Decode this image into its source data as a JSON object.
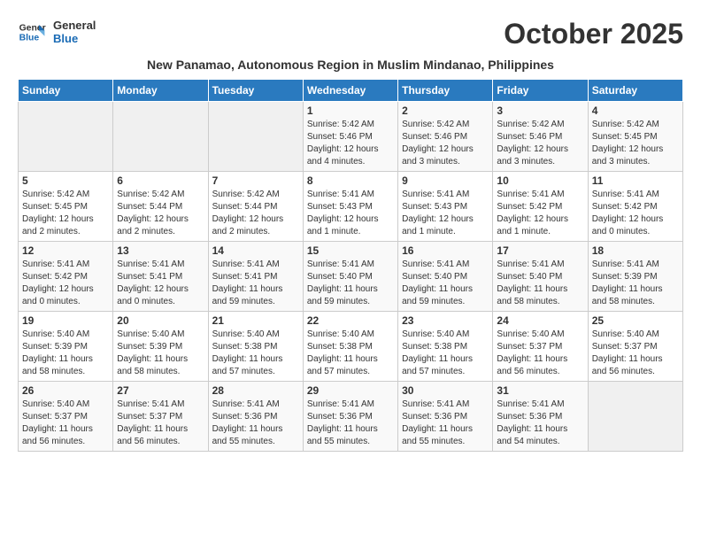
{
  "header": {
    "logo_line1": "General",
    "logo_line2": "Blue",
    "month_title": "October 2025",
    "subtitle": "New Panamao, Autonomous Region in Muslim Mindanao, Philippines"
  },
  "days_of_week": [
    "Sunday",
    "Monday",
    "Tuesday",
    "Wednesday",
    "Thursday",
    "Friday",
    "Saturday"
  ],
  "weeks": [
    [
      {
        "day": "",
        "info": ""
      },
      {
        "day": "",
        "info": ""
      },
      {
        "day": "",
        "info": ""
      },
      {
        "day": "1",
        "info": "Sunrise: 5:42 AM\nSunset: 5:46 PM\nDaylight: 12 hours\nand 4 minutes."
      },
      {
        "day": "2",
        "info": "Sunrise: 5:42 AM\nSunset: 5:46 PM\nDaylight: 12 hours\nand 3 minutes."
      },
      {
        "day": "3",
        "info": "Sunrise: 5:42 AM\nSunset: 5:46 PM\nDaylight: 12 hours\nand 3 minutes."
      },
      {
        "day": "4",
        "info": "Sunrise: 5:42 AM\nSunset: 5:45 PM\nDaylight: 12 hours\nand 3 minutes."
      }
    ],
    [
      {
        "day": "5",
        "info": "Sunrise: 5:42 AM\nSunset: 5:45 PM\nDaylight: 12 hours\nand 2 minutes."
      },
      {
        "day": "6",
        "info": "Sunrise: 5:42 AM\nSunset: 5:44 PM\nDaylight: 12 hours\nand 2 minutes."
      },
      {
        "day": "7",
        "info": "Sunrise: 5:42 AM\nSunset: 5:44 PM\nDaylight: 12 hours\nand 2 minutes."
      },
      {
        "day": "8",
        "info": "Sunrise: 5:41 AM\nSunset: 5:43 PM\nDaylight: 12 hours\nand 1 minute."
      },
      {
        "day": "9",
        "info": "Sunrise: 5:41 AM\nSunset: 5:43 PM\nDaylight: 12 hours\nand 1 minute."
      },
      {
        "day": "10",
        "info": "Sunrise: 5:41 AM\nSunset: 5:42 PM\nDaylight: 12 hours\nand 1 minute."
      },
      {
        "day": "11",
        "info": "Sunrise: 5:41 AM\nSunset: 5:42 PM\nDaylight: 12 hours\nand 0 minutes."
      }
    ],
    [
      {
        "day": "12",
        "info": "Sunrise: 5:41 AM\nSunset: 5:42 PM\nDaylight: 12 hours\nand 0 minutes."
      },
      {
        "day": "13",
        "info": "Sunrise: 5:41 AM\nSunset: 5:41 PM\nDaylight: 12 hours\nand 0 minutes."
      },
      {
        "day": "14",
        "info": "Sunrise: 5:41 AM\nSunset: 5:41 PM\nDaylight: 11 hours\nand 59 minutes."
      },
      {
        "day": "15",
        "info": "Sunrise: 5:41 AM\nSunset: 5:40 PM\nDaylight: 11 hours\nand 59 minutes."
      },
      {
        "day": "16",
        "info": "Sunrise: 5:41 AM\nSunset: 5:40 PM\nDaylight: 11 hours\nand 59 minutes."
      },
      {
        "day": "17",
        "info": "Sunrise: 5:41 AM\nSunset: 5:40 PM\nDaylight: 11 hours\nand 58 minutes."
      },
      {
        "day": "18",
        "info": "Sunrise: 5:41 AM\nSunset: 5:39 PM\nDaylight: 11 hours\nand 58 minutes."
      }
    ],
    [
      {
        "day": "19",
        "info": "Sunrise: 5:40 AM\nSunset: 5:39 PM\nDaylight: 11 hours\nand 58 minutes."
      },
      {
        "day": "20",
        "info": "Sunrise: 5:40 AM\nSunset: 5:39 PM\nDaylight: 11 hours\nand 58 minutes."
      },
      {
        "day": "21",
        "info": "Sunrise: 5:40 AM\nSunset: 5:38 PM\nDaylight: 11 hours\nand 57 minutes."
      },
      {
        "day": "22",
        "info": "Sunrise: 5:40 AM\nSunset: 5:38 PM\nDaylight: 11 hours\nand 57 minutes."
      },
      {
        "day": "23",
        "info": "Sunrise: 5:40 AM\nSunset: 5:38 PM\nDaylight: 11 hours\nand 57 minutes."
      },
      {
        "day": "24",
        "info": "Sunrise: 5:40 AM\nSunset: 5:37 PM\nDaylight: 11 hours\nand 56 minutes."
      },
      {
        "day": "25",
        "info": "Sunrise: 5:40 AM\nSunset: 5:37 PM\nDaylight: 11 hours\nand 56 minutes."
      }
    ],
    [
      {
        "day": "26",
        "info": "Sunrise: 5:40 AM\nSunset: 5:37 PM\nDaylight: 11 hours\nand 56 minutes."
      },
      {
        "day": "27",
        "info": "Sunrise: 5:41 AM\nSunset: 5:37 PM\nDaylight: 11 hours\nand 56 minutes."
      },
      {
        "day": "28",
        "info": "Sunrise: 5:41 AM\nSunset: 5:36 PM\nDaylight: 11 hours\nand 55 minutes."
      },
      {
        "day": "29",
        "info": "Sunrise: 5:41 AM\nSunset: 5:36 PM\nDaylight: 11 hours\nand 55 minutes."
      },
      {
        "day": "30",
        "info": "Sunrise: 5:41 AM\nSunset: 5:36 PM\nDaylight: 11 hours\nand 55 minutes."
      },
      {
        "day": "31",
        "info": "Sunrise: 5:41 AM\nSunset: 5:36 PM\nDaylight: 11 hours\nand 54 minutes."
      },
      {
        "day": "",
        "info": ""
      }
    ]
  ]
}
